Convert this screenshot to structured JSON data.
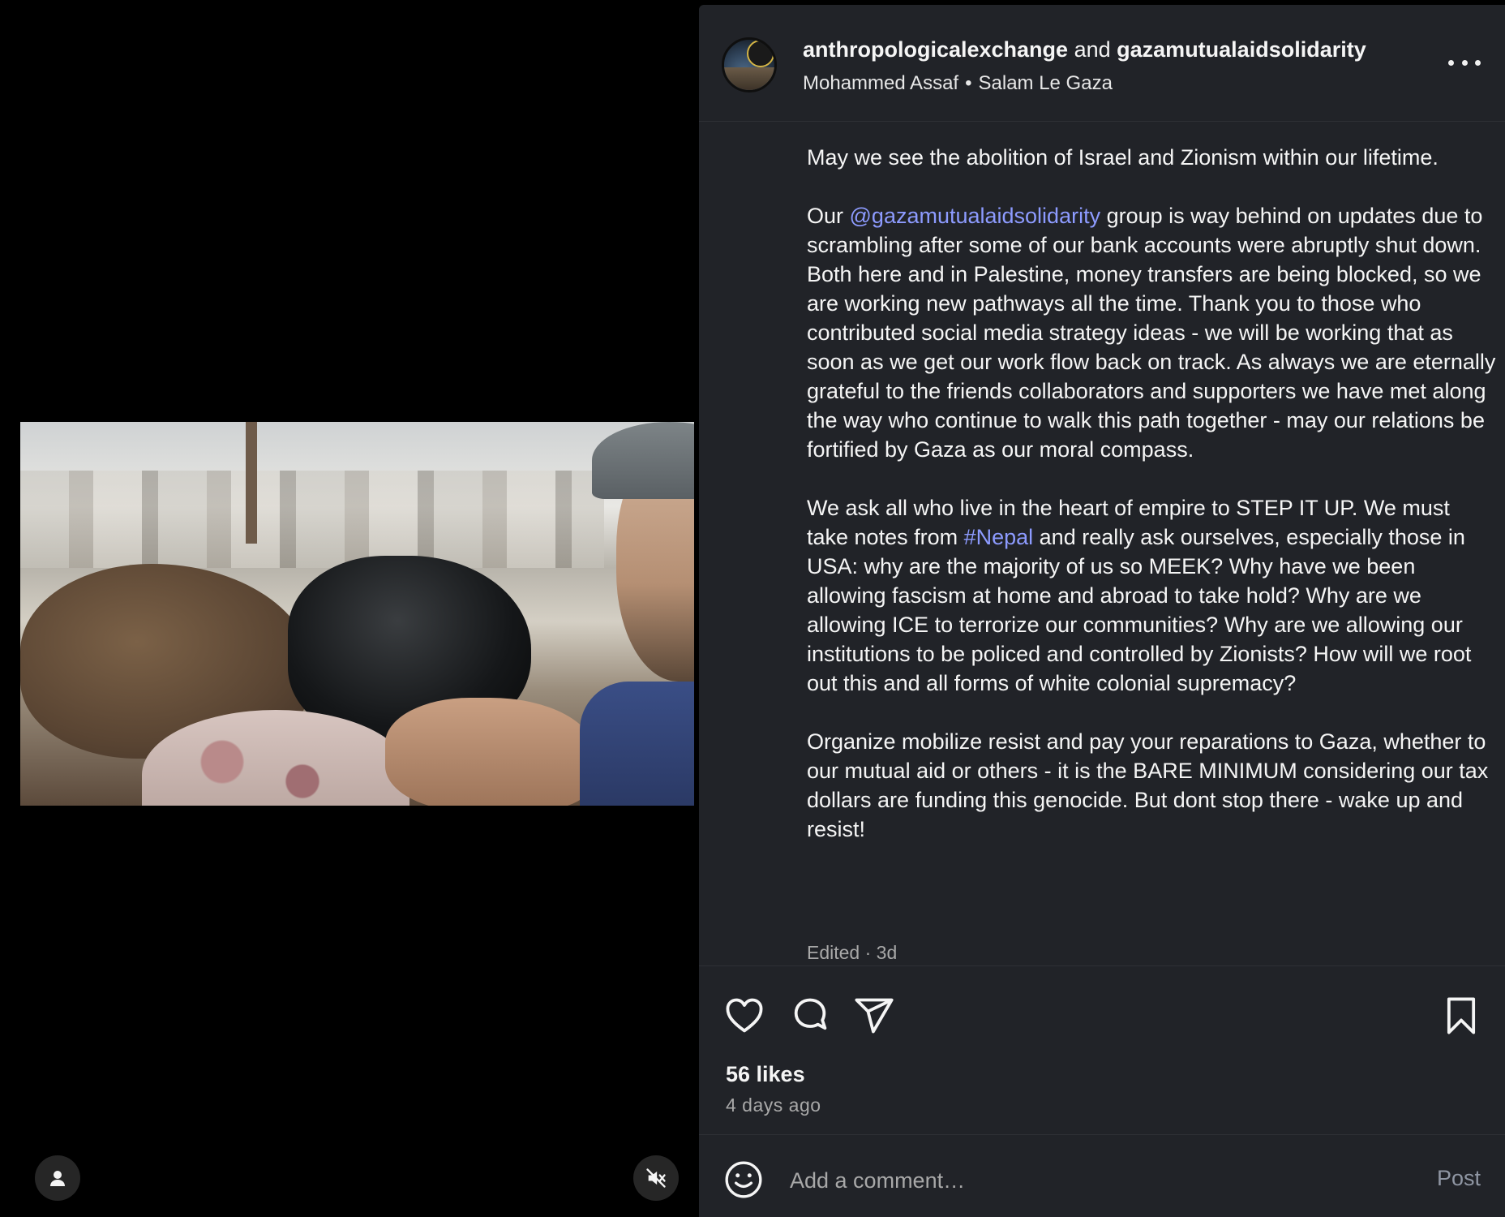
{
  "media": {
    "user_icon": "user-icon",
    "mute_icon": "speaker-muted-icon"
  },
  "header": {
    "author_1": "anthropologicalexchange",
    "conjunction": "and",
    "author_2": "gazamutualaidsolidarity",
    "audio_artist": "Mohammed Assaf",
    "separator": "•",
    "audio_track": "Salam Le Gaza",
    "more_icon": "more-options-icon"
  },
  "caption": {
    "p1": "May we see the abolition of Israel and Zionism within our lifetime.",
    "p2_prefix": "Our ",
    "p2_mention": "@gazamutualaidsolidarity",
    "p2_rest": " group is way behind on updates due to scrambling after some of our bank accounts were abruptly shut down. Both here and in Palestine, money transfers are being blocked, so we are working new pathways all the time. Thank you to those who contributed social media strategy ideas - we will be working that as soon as we get our work flow back on track. As always we are eternally grateful to the friends collaborators and supporters we have met along the way who continue to walk this path together - may our relations be fortified by Gaza as our moral compass.",
    "p3_prefix": "We ask all who live in the heart of empire to STEP IT UP. We must take notes from ",
    "p3_hashtag": "#Nepal",
    "p3_rest": " and really ask ourselves, especially those in USA: why are the majority of us so MEEK? Why have we been allowing fascism at home and abroad to take hold? Why are we allowing ICE to terrorize our communities? Why are we allowing our institutions to be policed and controlled by Zionists? How will we root out this and all forms of white colonial supremacy?",
    "p4": "Organize mobilize resist and pay your reparations to Gaza, whether to our mutual aid or others - it is the BARE MINIMUM considering our tax dollars are funding this genocide. But dont stop there - wake up and resist!",
    "meta": "Edited · 3d"
  },
  "actions": {
    "like_icon": "heart-icon",
    "comment_icon": "comment-icon",
    "share_icon": "paper-plane-icon",
    "save_icon": "bookmark-icon",
    "likes": "56 likes",
    "time_ago": "4 days ago"
  },
  "comment": {
    "emoji_icon": "emoji-icon",
    "placeholder": "Add a comment…",
    "post_label": "Post"
  },
  "colors": {
    "panel_bg": "#212328",
    "link": "#8d9bff",
    "muted_text": "#a8a8a8"
  }
}
